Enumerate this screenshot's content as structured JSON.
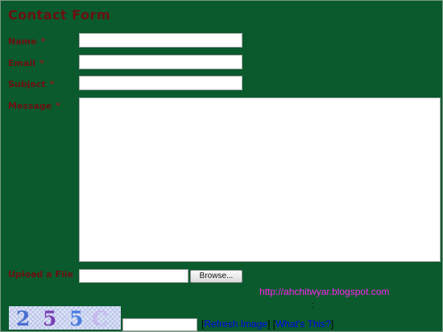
{
  "form": {
    "title": "Contact Form",
    "fields": {
      "name": {
        "label": "Name",
        "required_mark": "*",
        "value": ""
      },
      "email": {
        "label": "Email",
        "required_mark": "*",
        "value": ""
      },
      "subject": {
        "label": "Subject",
        "required_mark": "*",
        "value": ""
      },
      "message": {
        "label": "Message",
        "required_mark": "*",
        "value": ""
      }
    },
    "upload": {
      "label": "Upload a File",
      "browse_label": "Browse..."
    },
    "footer_url": "http://ahchitwyar.blogspot.com",
    "colon": ":",
    "captcha": {
      "characters": [
        "2",
        "5",
        "5",
        "C"
      ],
      "colors": [
        "#4a6fd0",
        "#7b3fb4",
        "#4a7de0",
        "#c8b8f0"
      ],
      "answer_value": "",
      "bracket_open": "[",
      "bracket_close": "]",
      "refresh_label": "Refresh Image",
      "whats_this_label": "What's This?"
    }
  },
  "colors": {
    "background": "#0a5a2d",
    "label": "#6b1010",
    "url": "#ff22ee",
    "link": "#0000ee"
  }
}
